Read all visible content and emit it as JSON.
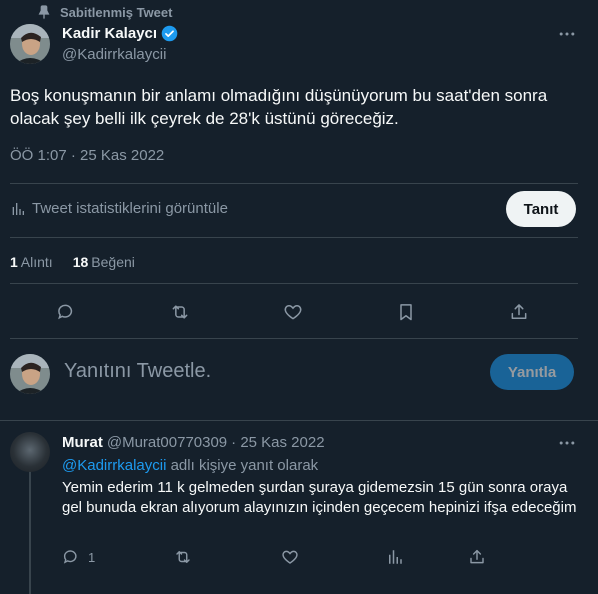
{
  "pinned_label": "Sabitlenmiş Tweet",
  "author": {
    "name": "Kadir Kalaycı",
    "handle": "@Kadirrkalaycii",
    "verified": true
  },
  "tweet": {
    "text": "Boş konuşmanın bir anlamı olmadığını düşünüyorum bu saat'den sonra olacak şey belli ilk çeyrek de 28'k üstünü göreceğiz.",
    "time": "ÖÖ 1:07 · 25 Kas 2022"
  },
  "stats": {
    "view_label": "Tweet istatistiklerini görüntüle",
    "promote_label": "Tanıt"
  },
  "counts": {
    "quotes_value": "1",
    "quotes_label": "Alıntı",
    "likes_value": "18",
    "likes_label": "Beğeni"
  },
  "composer": {
    "placeholder": "Yanıtını Tweetle.",
    "reply_button": "Yanıtla"
  },
  "reply": {
    "name": "Murat",
    "handle": "@Murat00770309",
    "date": "· 25 Kas 2022",
    "mention": "@Kadirrkalaycii",
    "replying_suffix": "adlı kişiye yanıt olarak",
    "text": "Yemin ederim 11 k gelmeden şurdan şuraya gidemezsin 15 gün sonra oraya gel bunuda ekran alıyorum alayınızın içinden geçecem hepinizi ifşa edeceğim",
    "reply_count": "1"
  },
  "colors": {
    "background": "#15202b",
    "accent": "#1d9bf0",
    "muted": "#8b98a5",
    "divider": "#38444d"
  }
}
